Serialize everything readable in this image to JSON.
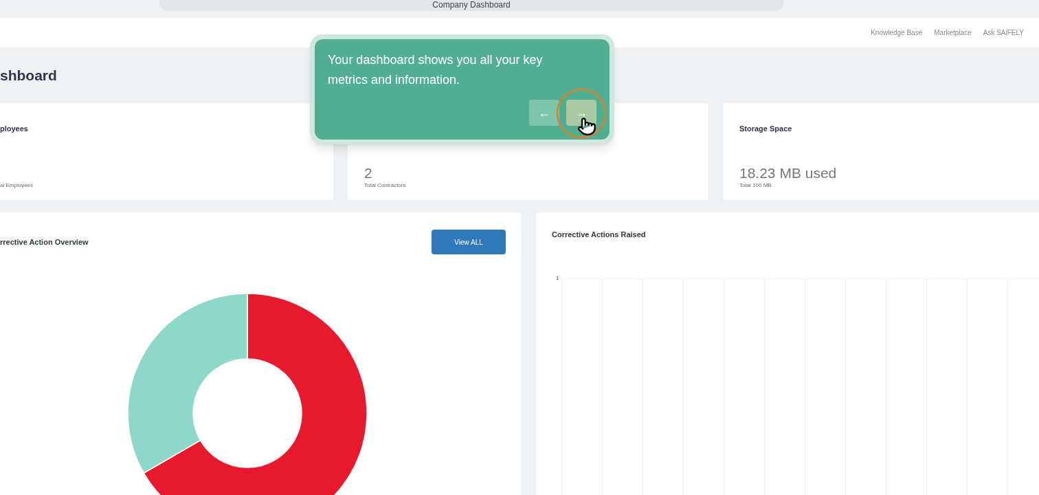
{
  "top_bar": {
    "title": "Company Dashboard"
  },
  "header": {
    "links": [
      {
        "label": "Knowledge Base"
      },
      {
        "label": "Marketplace"
      },
      {
        "label": "Ask SAiFELY"
      }
    ]
  },
  "page_title": "shboard",
  "stat_cards": [
    {
      "title": "ployees",
      "label": "al Employees"
    },
    {
      "value": "2",
      "label": "Total Contractors"
    },
    {
      "title": "Storage Space",
      "value": "18.23 MB used",
      "label": "Total 100 MB"
    }
  ],
  "overview_card": {
    "title": "rrective Action Overview",
    "button": "View ALL"
  },
  "raised_card": {
    "title": "Corrective Actions Raised",
    "y_tick": "1"
  },
  "tour_tooltip": {
    "text": "Your dashboard shows you all your key metrics and information.",
    "buttons": [
      {
        "label": "←",
        "kind": "prev"
      },
      {
        "label": "→",
        "kind": "next"
      }
    ]
  }
}
